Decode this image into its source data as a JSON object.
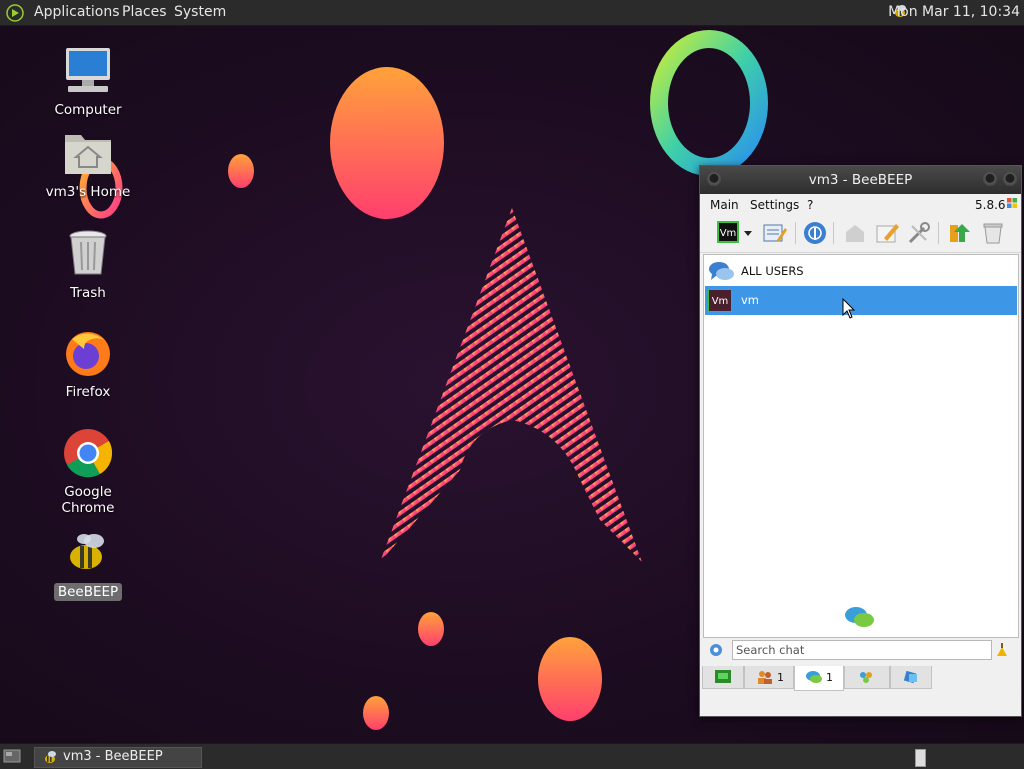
{
  "top_panel": {
    "menus": [
      "Applications",
      "Places",
      "System"
    ],
    "clock": "Mon Mar 11, 10:34"
  },
  "desktop": {
    "icons": [
      {
        "label": "Computer"
      },
      {
        "label": "vm3's Home"
      },
      {
        "label": "Trash"
      },
      {
        "label": "Firefox"
      },
      {
        "label": "Google Chrome"
      },
      {
        "label": "BeeBEEP"
      }
    ]
  },
  "window": {
    "title": "vm3 - BeeBEEP",
    "menu": {
      "main": "Main",
      "settings": "Settings",
      "help": "?",
      "version": "5.8.6"
    },
    "status_avatar": "Vm",
    "users": [
      {
        "label": "ALL USERS",
        "icon": "chat-bubbles-icon"
      },
      {
        "label": "vm",
        "avatar": "Vm"
      }
    ],
    "search": {
      "placeholder": "Search chat",
      "value": ""
    },
    "tabs": [
      {
        "icon": "screen-icon",
        "count": ""
      },
      {
        "icon": "users-icon",
        "count": "1"
      },
      {
        "icon": "chats-icon",
        "count": "1"
      },
      {
        "icon": "groups-icon",
        "count": ""
      },
      {
        "icon": "shares-icon",
        "count": ""
      }
    ]
  },
  "bottom_panel": {
    "task": "vm3 - BeeBEEP"
  },
  "colors": {
    "panel": "#2b2b2b",
    "selection": "#3d97e6",
    "wallpaper": "#1d0c21"
  }
}
